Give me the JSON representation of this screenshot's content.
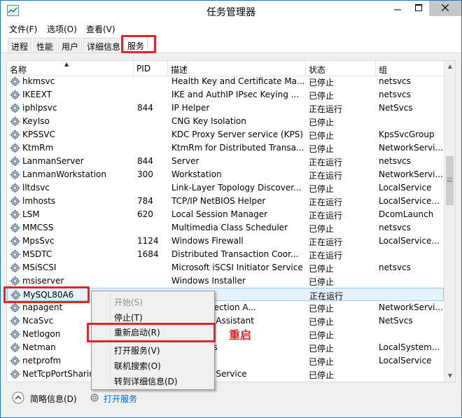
{
  "window": {
    "title": "任务管理器"
  },
  "menu": [
    "文件(F)",
    "选项(O)",
    "查看(V)"
  ],
  "tabs": [
    "进程",
    "性能",
    "用户",
    "详细信息",
    "服务"
  ],
  "active_tab": "服务",
  "columns": {
    "name": "名称",
    "pid": "PID",
    "desc": "描述",
    "status": "状态",
    "group": "组"
  },
  "rows": [
    {
      "name": "hkmsvc",
      "pid": "",
      "desc": "Health Key and Certificate Ma...",
      "status": "已停止",
      "group": "netsvcs"
    },
    {
      "name": "IKEEXT",
      "pid": "",
      "desc": "IKE and AuthIP IPsec Keying ...",
      "status": "已停止",
      "group": "netsvcs"
    },
    {
      "name": "iphlpsvc",
      "pid": "844",
      "desc": "IP Helper",
      "status": "正在运行",
      "group": "NetSvcs"
    },
    {
      "name": "KeyIso",
      "pid": "",
      "desc": "CNG Key Isolation",
      "status": "已停止",
      "group": ""
    },
    {
      "name": "KPSSVC",
      "pid": "",
      "desc": "KDC Proxy Server service (KPS)",
      "status": "已停止",
      "group": "KpsSvcGroup"
    },
    {
      "name": "KtmRm",
      "pid": "",
      "desc": "KtmRm for Distributed Transa...",
      "status": "已停止",
      "group": "NetworkServi..."
    },
    {
      "name": "LanmanServer",
      "pid": "844",
      "desc": "Server",
      "status": "正在运行",
      "group": "netsvcs"
    },
    {
      "name": "LanmanWorkstation",
      "pid": "300",
      "desc": "Workstation",
      "status": "正在运行",
      "group": "NetworkServi..."
    },
    {
      "name": "lltdsvc",
      "pid": "",
      "desc": "Link-Layer Topology Discover...",
      "status": "已停止",
      "group": "LocalService"
    },
    {
      "name": "lmhosts",
      "pid": "784",
      "desc": "TCP/IP NetBIOS Helper",
      "status": "正在运行",
      "group": "LocalService..."
    },
    {
      "name": "LSM",
      "pid": "620",
      "desc": "Local Session Manager",
      "status": "正在运行",
      "group": "DcomLaunch"
    },
    {
      "name": "MMCSS",
      "pid": "",
      "desc": "Multimedia Class Scheduler",
      "status": "已停止",
      "group": "netsvcs"
    },
    {
      "name": "MpsSvc",
      "pid": "1124",
      "desc": "Windows Firewall",
      "status": "正在运行",
      "group": "LocalService..."
    },
    {
      "name": "MSDTC",
      "pid": "1684",
      "desc": "Distributed Transaction Coor...",
      "status": "正在运行",
      "group": ""
    },
    {
      "name": "MSiSCSI",
      "pid": "",
      "desc": "Microsoft iSCSI Initiator Service",
      "status": "已停止",
      "group": "netsvcs"
    },
    {
      "name": "msiserver",
      "pid": "",
      "desc": "Windows Installer",
      "status": "已停止",
      "group": ""
    },
    {
      "name": "MySQL80A6",
      "pid": "",
      "desc": "6",
      "status": "正在运行",
      "group": ""
    },
    {
      "name": "napagent",
      "pid": "",
      "desc": "ccess Protection A...",
      "status": "已停止",
      "group": "NetworkServi..."
    },
    {
      "name": "NcaSvc",
      "pid": "",
      "desc": "nnectivity Assistant",
      "status": "已停止",
      "group": "NetSvcs"
    },
    {
      "name": "Netlogon",
      "pid": "",
      "desc": "",
      "status": "已停止",
      "group": ""
    },
    {
      "name": "Netman",
      "pid": "",
      "desc": "onnections",
      "status": "已停止",
      "group": "LocalSystem..."
    },
    {
      "name": "netprofm",
      "pid": "",
      "desc": "st Service",
      "status": "已停止",
      "group": "LocalService"
    },
    {
      "name": "NetTcpPortSharing",
      "pid": "",
      "desc": "rt Sharing Service",
      "status": "已停止",
      "group": ""
    }
  ],
  "selected_row": "MySQL80A6",
  "context_menu": {
    "start": "开始(S)",
    "stop": "停止(T)",
    "restart": "重新启动(R)",
    "open_services": "打开服务(V)",
    "search_online": "联机搜索(O)",
    "go_to_details": "转到详细信息(D)"
  },
  "annotation": "重启",
  "footer": {
    "fewer_details": "简略信息(D)",
    "open_services": "打开服务"
  },
  "colors": {
    "highlight_red": "#e0262c",
    "link_blue": "#0066cc",
    "selected_row": "#e5f1fb"
  }
}
